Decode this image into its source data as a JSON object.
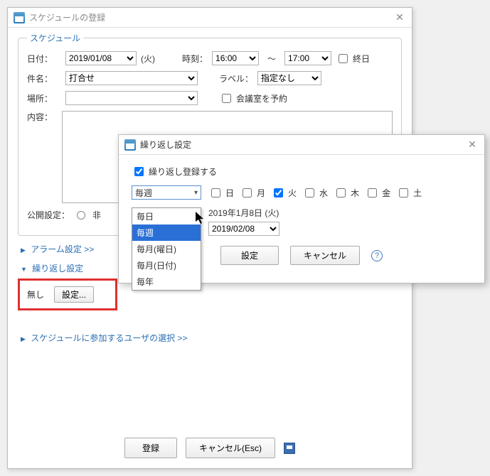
{
  "main_window": {
    "title": "スケジュールの登録",
    "group_schedule": "スケジュール",
    "labels": {
      "date": "日付：",
      "time": "時刻：",
      "subject": "件名：",
      "label": "ラベル：",
      "place": "場所：",
      "content": "内容：",
      "public": "公開設定："
    },
    "date_value": "2019/01/08",
    "date_weekday": "(火)",
    "time_from": "16:00",
    "time_to": "17:00",
    "tilde": "〜",
    "allday": "終日",
    "subject_value": "打合せ",
    "label_value": "指定なし",
    "reserve_room": "会議室を予約",
    "public_private": "非",
    "alarm_link": "アラーム設定 >>",
    "repeat_section": "繰り返し設定",
    "repeat_none": "無し",
    "repeat_set_btn": "設定...",
    "participants_link": "スケジュールに参加するユーザの選択 >>",
    "footer": {
      "register": "登録",
      "cancel": "キャンセル(Esc)"
    }
  },
  "dialog2": {
    "title": "繰り返し設定",
    "enable": "繰り返し登録する",
    "freq_value": "毎週",
    "freq_options": [
      "毎日",
      "毎週",
      "毎月(曜日)",
      "毎月(日付)",
      "毎年"
    ],
    "freq_selected_index": 1,
    "weekdays": [
      "日",
      "月",
      "火",
      "水",
      "木",
      "金",
      "土"
    ],
    "weekday_checked": [
      false,
      false,
      true,
      false,
      false,
      false,
      false
    ],
    "start_text": "2019年1月8日 (火)",
    "end_value": "2019/02/08",
    "set_btn": "設定",
    "cancel_btn": "キャンセル"
  }
}
